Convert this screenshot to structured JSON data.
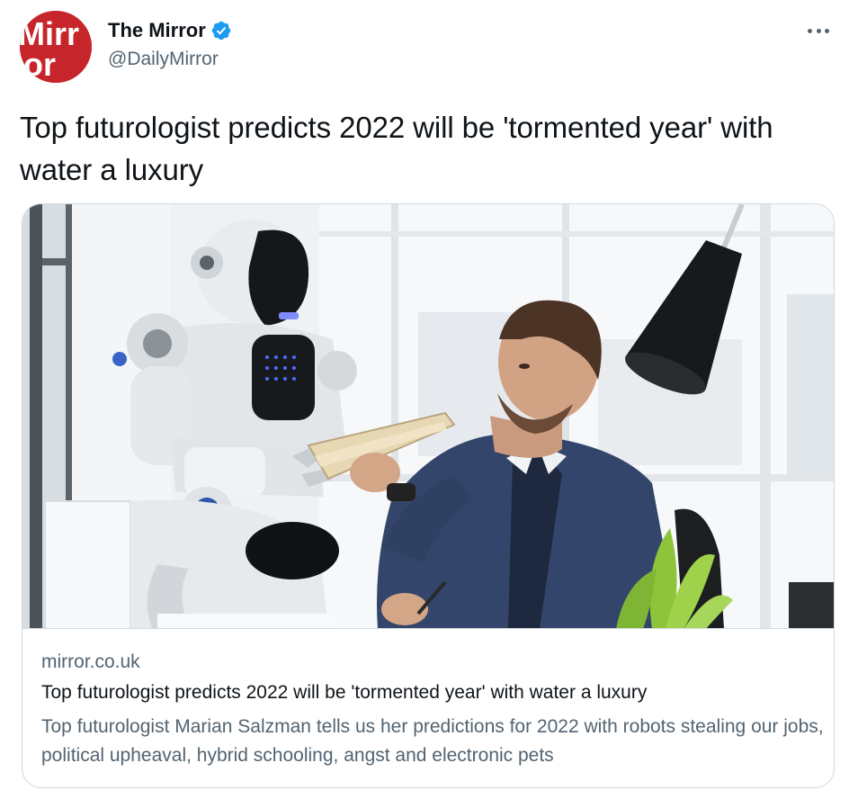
{
  "tweet": {
    "author": {
      "display_name": "The Mirror",
      "handle": "@DailyMirror",
      "verified_icon": "verified-badge-icon",
      "avatar_logo_text": "Mirror",
      "brand_color": "#c6262b"
    },
    "text": "Top futurologist predicts 2022 will be 'tormented year' with water a luxury",
    "more_icon": "more-horizontal-icon",
    "card": {
      "domain": "mirror.co.uk",
      "title": "Top futurologist predicts 2022 will be 'tormented year' with water a luxury",
      "description": "Top futurologist Marian Salzman tells us her predictions for 2022 with robots stealing our jobs, political upheaval, hybrid schooling, angst and electronic pets",
      "image_subject": "humanoid-robot-handing-folder-to-businessman"
    }
  },
  "colors": {
    "text_primary": "#0f1419",
    "text_secondary": "#536471",
    "border": "#cfd9de",
    "verified_blue": "#1d9bf0"
  }
}
